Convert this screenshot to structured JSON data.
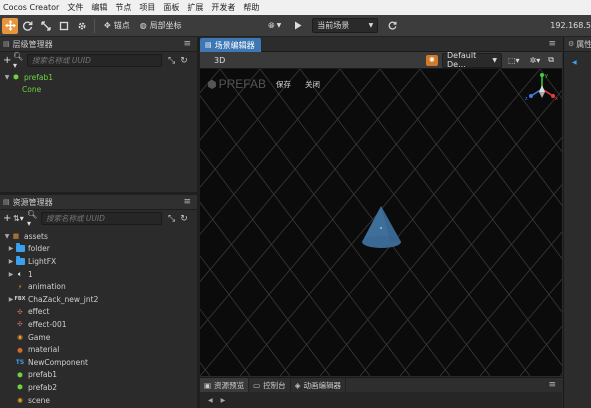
{
  "menubar": {
    "app_title": "Cocos Creator",
    "items": [
      "文件",
      "编辑",
      "节点",
      "项目",
      "面板",
      "扩展",
      "开发者",
      "帮助"
    ]
  },
  "toolbar": {
    "pivot_label": "锚点",
    "local_label": "局部坐标",
    "scene_dropdown": "当前场景",
    "ip_text": "192.168.5"
  },
  "hierarchy": {
    "title": "层级管理器",
    "search_placeholder": "搜索名称或 UUID",
    "nodes": [
      {
        "label": "prefab1",
        "color": "#6fd040",
        "level": 0,
        "expanded": true
      },
      {
        "label": "Cone",
        "color": "#6fd040",
        "level": 1
      }
    ]
  },
  "assets": {
    "title": "资源管理器",
    "search_placeholder": "搜索名称或 UUID",
    "root": "assets",
    "items": [
      {
        "label": "folder",
        "icon": "folder-icon",
        "arrow": true
      },
      {
        "label": "LightFX",
        "icon": "folder-icon",
        "arrow": true
      },
      {
        "label": "1",
        "icon": "audio-icon",
        "arrow": true
      },
      {
        "label": "animation",
        "icon": "animation-icon",
        "arrow": false
      },
      {
        "label": "ChaZack_new_jnt2",
        "icon": "fbx-icon",
        "arrow": true
      },
      {
        "label": "effect",
        "icon": "effect-icon",
        "arrow": false
      },
      {
        "label": "effect-001",
        "icon": "effect-icon",
        "arrow": false
      },
      {
        "label": "Game",
        "icon": "scene-icon",
        "arrow": false
      },
      {
        "label": "material",
        "icon": "material-icon",
        "arrow": false
      },
      {
        "label": "NewComponent",
        "icon": "typescript-icon",
        "arrow": false
      },
      {
        "label": "prefab1",
        "icon": "prefab-icon",
        "arrow": false
      },
      {
        "label": "prefab2",
        "icon": "prefab-icon",
        "arrow": false
      },
      {
        "label": "scene",
        "icon": "scene-icon",
        "arrow": false
      }
    ]
  },
  "scene_editor": {
    "tab_label": "场景编辑器",
    "mode_3d": "3D",
    "camera_dropdown": "Default De...",
    "prefab_watermark": "PREFAB",
    "save_label": "保存",
    "close_label": "关闭",
    "gizmo_axes": {
      "x": "x",
      "y": "y",
      "z": "z"
    }
  },
  "bottom_tabs": [
    "资源预览",
    "控制台",
    "动画编辑器"
  ],
  "right_panel": {
    "title": "属性"
  },
  "colors": {
    "accent": "#3d78b5",
    "active_tool": "#e8943a",
    "node_green": "#6fd040",
    "cone": "#3d6f9a"
  }
}
